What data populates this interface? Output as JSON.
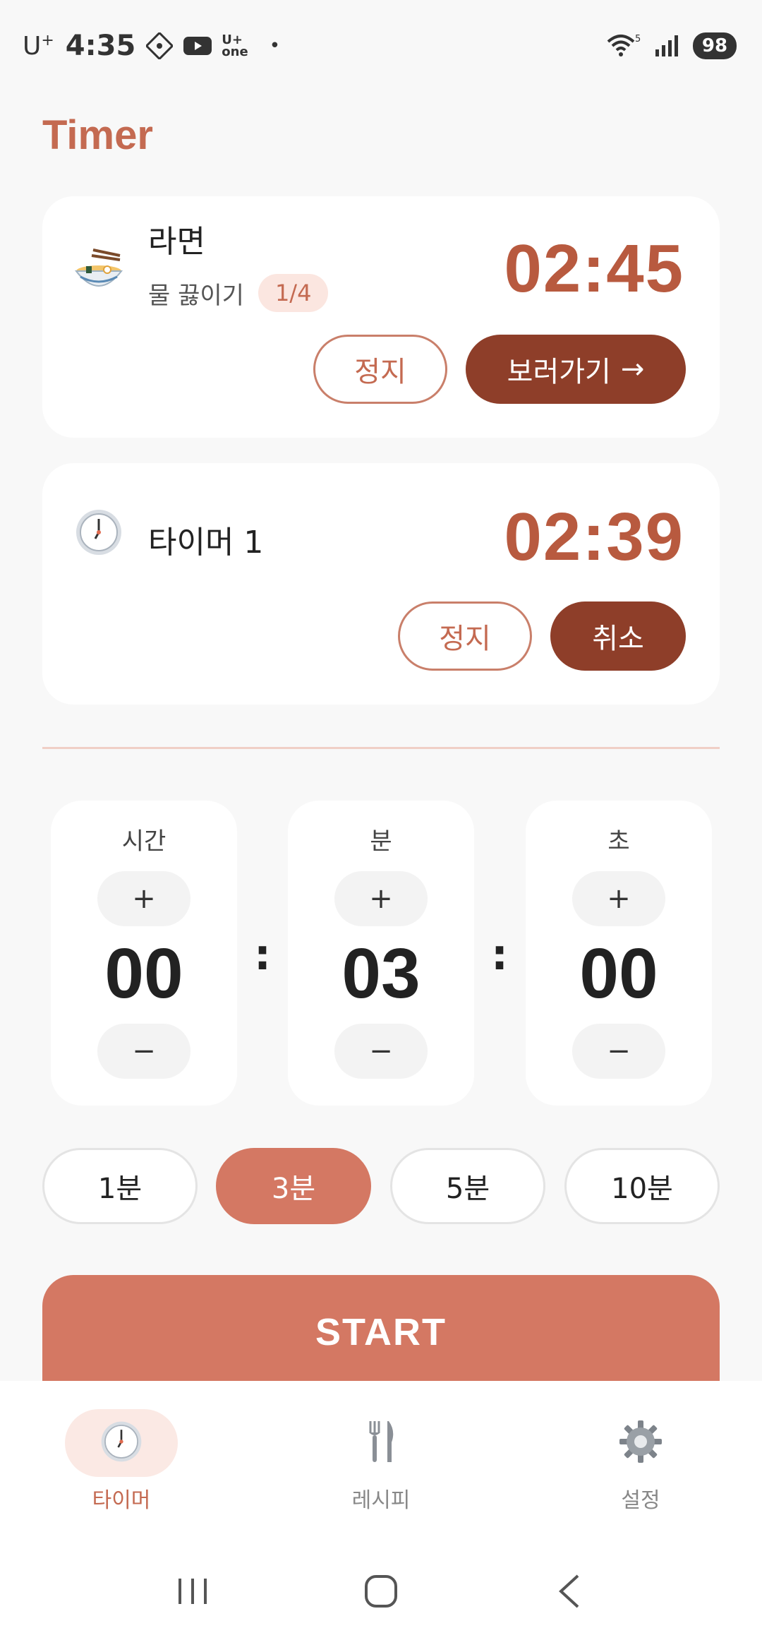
{
  "status_bar": {
    "carrier": "U",
    "carrier_sup": "+",
    "time": "4:35",
    "uplus_top": "U+",
    "uplus_bottom": "one",
    "dot": "•",
    "battery": "98",
    "network": "5"
  },
  "page": {
    "title": "Timer"
  },
  "active_timers": [
    {
      "icon": "ramen-bowl-icon",
      "name": "라면",
      "step": "물 끓이기",
      "step_badge": "1/4",
      "time": "02:45",
      "stop_label": "정지",
      "action_label": "보러가기",
      "action_arrow": "→"
    },
    {
      "icon": "clock-icon",
      "name": "타이머 1",
      "time": "02:39",
      "stop_label": "정지",
      "action_label": "취소"
    }
  ],
  "picker": {
    "hours": {
      "label": "시간",
      "value": "00"
    },
    "minutes": {
      "label": "분",
      "value": "03"
    },
    "seconds": {
      "label": "초",
      "value": "00"
    },
    "plus": "+",
    "minus": "−",
    "separator": ":"
  },
  "presets": [
    {
      "label": "1분",
      "active": false
    },
    {
      "label": "3분",
      "active": true
    },
    {
      "label": "5분",
      "active": false
    },
    {
      "label": "10분",
      "active": false
    }
  ],
  "start_label": "START",
  "bottom_nav": [
    {
      "label": "타이머",
      "icon": "clock-icon",
      "active": true
    },
    {
      "label": "레시피",
      "icon": "fork-knife-icon",
      "active": false
    },
    {
      "label": "설정",
      "icon": "gear-icon",
      "active": false
    }
  ],
  "colors": {
    "accent": "#c46a51",
    "accent_dark": "#8e3e29",
    "accent_light": "#d47863",
    "badge_bg": "#fbe6e0"
  }
}
